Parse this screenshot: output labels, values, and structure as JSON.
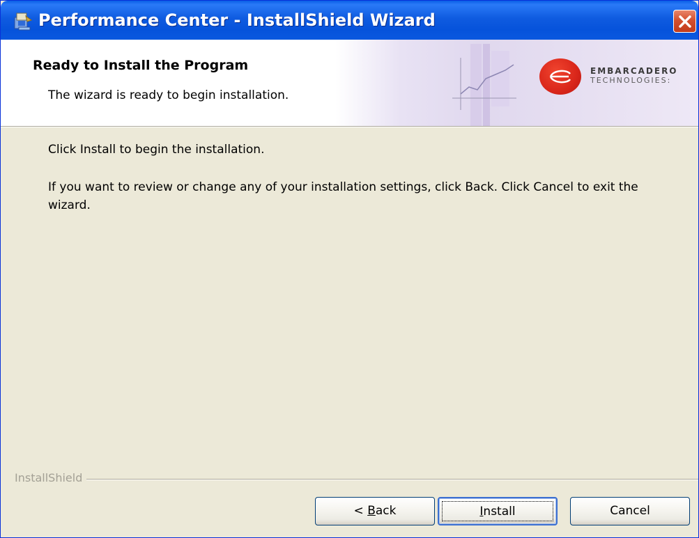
{
  "window": {
    "title": "Performance Center - InstallShield Wizard",
    "titlebar_color": "#0A5FE7",
    "close_button_color": "#D4502F"
  },
  "banner": {
    "heading": "Ready to Install the Program",
    "subheading": "The wizard is ready to begin installation.",
    "logo": {
      "name": "EMBARCADERO",
      "sub": "TECHNOLOGIES:"
    }
  },
  "body": {
    "line1": "Click Install to begin the installation.",
    "line2": "If you want to review or change any of your installation settings, click Back. Click Cancel to exit the wizard."
  },
  "footer": {
    "brand": "InstallShield"
  },
  "buttons": {
    "back": {
      "prefix": "< ",
      "mnemonic": "B",
      "rest": "ack"
    },
    "install": {
      "mnemonic": "I",
      "rest": "nstall"
    },
    "cancel": "Cancel"
  },
  "icons": {
    "title": "installer-icon",
    "close": "close-icon",
    "logo": "embarcadero-logo-icon",
    "banner_art": "chart-graphic-icon"
  }
}
